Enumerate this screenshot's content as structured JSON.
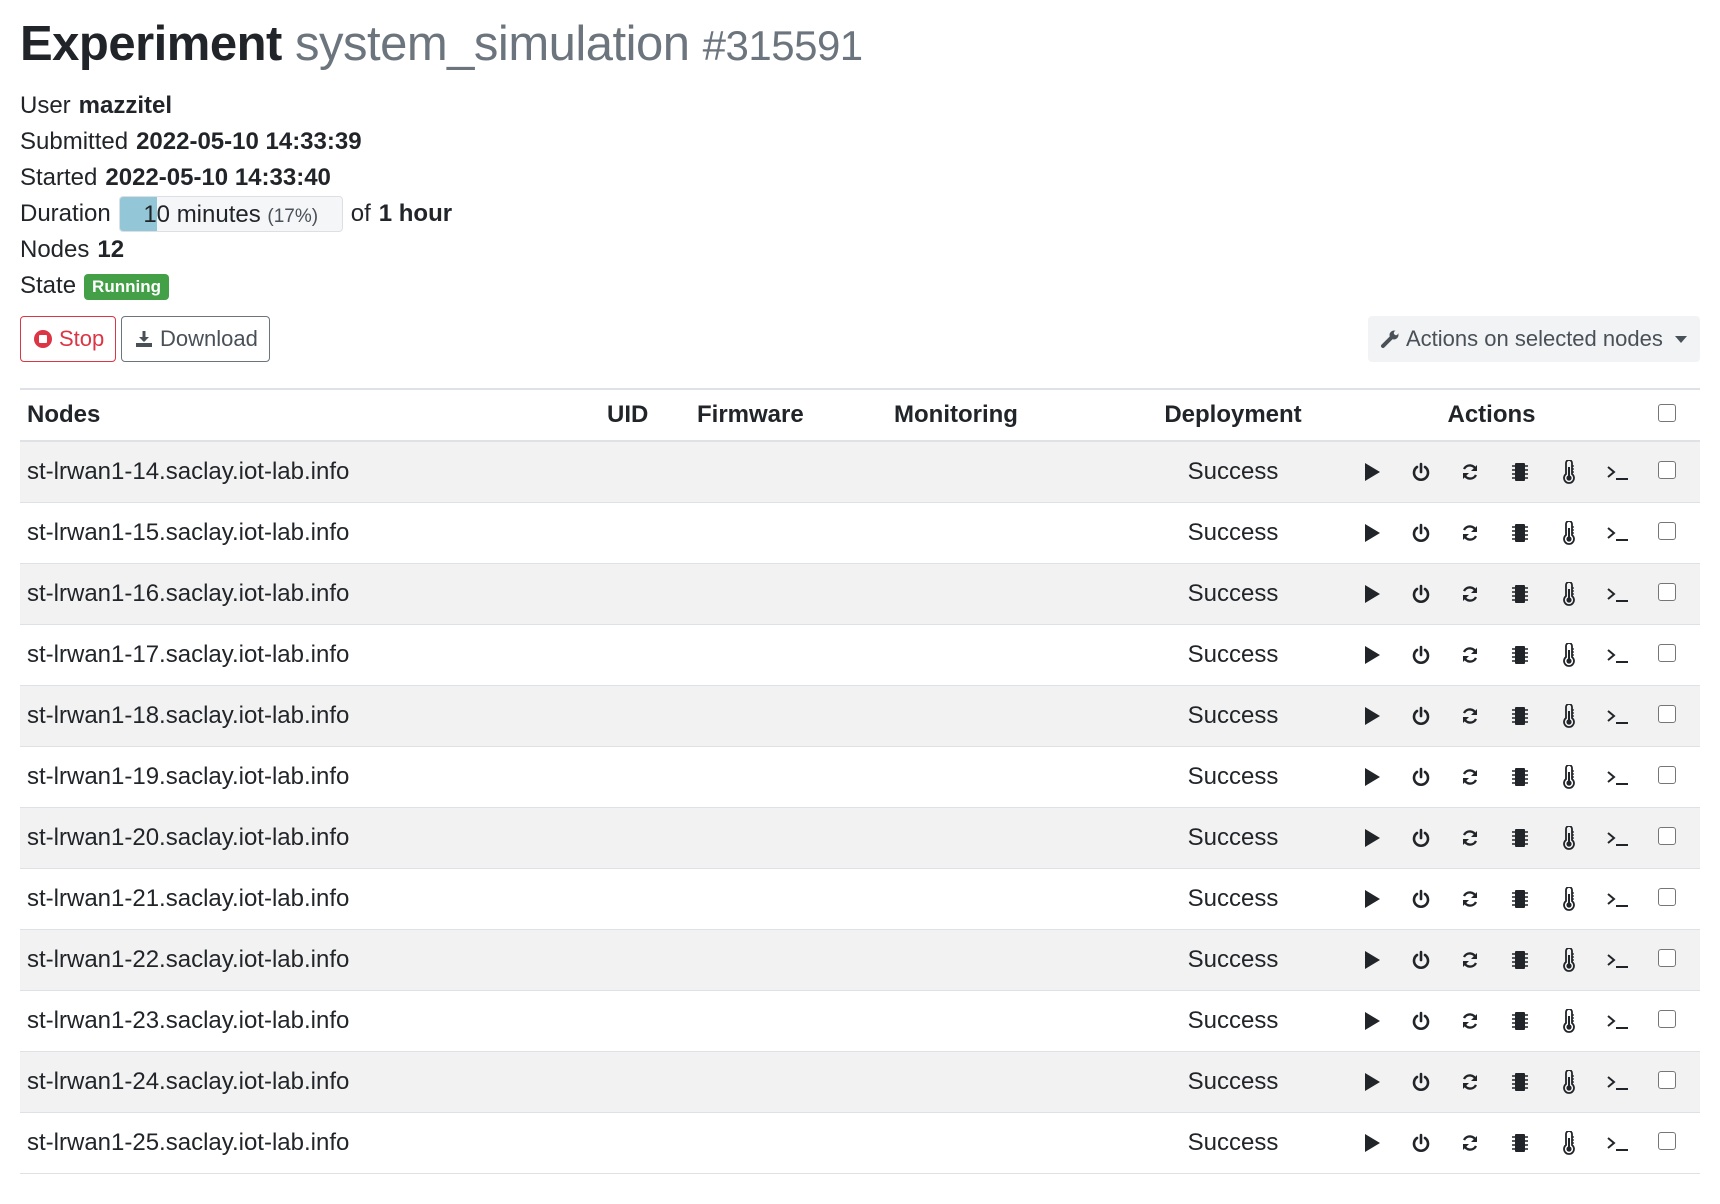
{
  "header": {
    "title_prefix": "Experiment",
    "experiment_name": "system_simulation",
    "experiment_id": "#315591"
  },
  "meta": {
    "user_label": "User",
    "user": "mazzitel",
    "submitted_label": "Submitted",
    "submitted": "2022-05-10 14:33:39",
    "started_label": "Started",
    "started": "2022-05-10 14:33:40",
    "duration_label": "Duration",
    "duration_elapsed": "10 minutes",
    "duration_percent_text": "(17%)",
    "duration_progress": 0.17,
    "duration_of": "of",
    "duration_total": "1 hour",
    "nodes_label": "Nodes",
    "nodes_count": "12",
    "state_label": "State",
    "state": "Running",
    "state_color": "#43a047"
  },
  "toolbar": {
    "stop_label": "Stop",
    "stop_icon": "stop-circle-icon",
    "download_label": "Download",
    "download_icon": "download-icon",
    "actions_label": "Actions on selected nodes",
    "actions_icon": "wrench-icon"
  },
  "table": {
    "columns": {
      "nodes": "Nodes",
      "uid": "UID",
      "firmware": "Firmware",
      "monitoring": "Monitoring",
      "deployment": "Deployment",
      "actions": "Actions"
    },
    "action_icons": [
      "start-icon",
      "power-icon",
      "reset-icon",
      "chip-icon",
      "thermometer-icon",
      "terminal-icon"
    ],
    "rows": [
      {
        "node": "st-lrwan1-14.saclay.iot-lab.info",
        "uid": "",
        "firmware": "",
        "monitoring": "",
        "deployment": "Success"
      },
      {
        "node": "st-lrwan1-15.saclay.iot-lab.info",
        "uid": "",
        "firmware": "",
        "monitoring": "",
        "deployment": "Success"
      },
      {
        "node": "st-lrwan1-16.saclay.iot-lab.info",
        "uid": "",
        "firmware": "",
        "monitoring": "",
        "deployment": "Success"
      },
      {
        "node": "st-lrwan1-17.saclay.iot-lab.info",
        "uid": "",
        "firmware": "",
        "monitoring": "",
        "deployment": "Success"
      },
      {
        "node": "st-lrwan1-18.saclay.iot-lab.info",
        "uid": "",
        "firmware": "",
        "monitoring": "",
        "deployment": "Success"
      },
      {
        "node": "st-lrwan1-19.saclay.iot-lab.info",
        "uid": "",
        "firmware": "",
        "monitoring": "",
        "deployment": "Success"
      },
      {
        "node": "st-lrwan1-20.saclay.iot-lab.info",
        "uid": "",
        "firmware": "",
        "monitoring": "",
        "deployment": "Success"
      },
      {
        "node": "st-lrwan1-21.saclay.iot-lab.info",
        "uid": "",
        "firmware": "",
        "monitoring": "",
        "deployment": "Success"
      },
      {
        "node": "st-lrwan1-22.saclay.iot-lab.info",
        "uid": "",
        "firmware": "",
        "monitoring": "",
        "deployment": "Success"
      },
      {
        "node": "st-lrwan1-23.saclay.iot-lab.info",
        "uid": "",
        "firmware": "",
        "monitoring": "",
        "deployment": "Success"
      },
      {
        "node": "st-lrwan1-24.saclay.iot-lab.info",
        "uid": "",
        "firmware": "",
        "monitoring": "",
        "deployment": "Success"
      },
      {
        "node": "st-lrwan1-25.saclay.iot-lab.info",
        "uid": "",
        "firmware": "",
        "monitoring": "",
        "deployment": "Success"
      }
    ]
  }
}
